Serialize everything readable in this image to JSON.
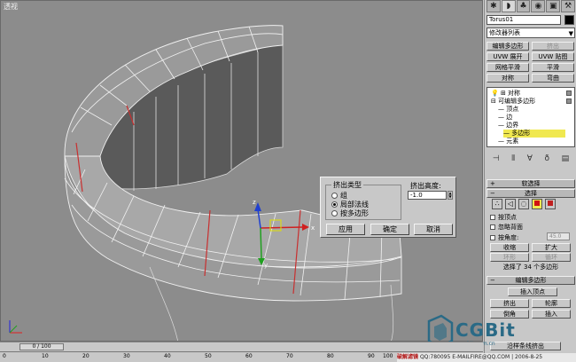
{
  "viewport": {
    "label": "透视",
    "axis_x": "x",
    "axis_y": "y",
    "axis_z": "z"
  },
  "dialog": {
    "group_title": "挤出类型",
    "options": [
      {
        "label": "组",
        "selected": false
      },
      {
        "label": "局部法线",
        "selected": true
      },
      {
        "label": "按多边形",
        "selected": false
      }
    ],
    "height_label": "挤出高度:",
    "height_value": "-1.0",
    "buttons": {
      "apply": "应用",
      "ok": "确定",
      "cancel": "取消"
    }
  },
  "panel": {
    "tab_icons": [
      "create-icon",
      "modify-icon",
      "hierarchy-icon",
      "motion-icon",
      "display-icon",
      "utilities-icon"
    ],
    "object_name": "Torus01",
    "object_color": "#000000",
    "modifier_list": "修改器列表",
    "mod_buttons": [
      {
        "label": "编辑多边形",
        "disabled": false
      },
      {
        "label": "挤出",
        "disabled": true
      },
      {
        "label": "UVW 展开",
        "disabled": false
      },
      {
        "label": "UVW 贴图",
        "disabled": false
      },
      {
        "label": "网格平滑",
        "disabled": false
      },
      {
        "label": "平滑",
        "disabled": false
      },
      {
        "label": "对称",
        "disabled": false
      },
      {
        "label": "弯曲",
        "disabled": false
      }
    ],
    "stack": [
      {
        "label": "对称",
        "indent": 0,
        "selected": false
      },
      {
        "label": "可编辑多边形",
        "indent": 0,
        "selected": false
      },
      {
        "label": "顶点",
        "indent": 1,
        "selected": false
      },
      {
        "label": "边",
        "indent": 1,
        "selected": false
      },
      {
        "label": "边界",
        "indent": 1,
        "selected": false
      },
      {
        "label": "多边形",
        "indent": 1,
        "selected": true
      },
      {
        "label": "元素",
        "indent": 1,
        "selected": false
      }
    ],
    "rollout_soft": "软选择",
    "rollout_select": "选择",
    "by_vertex": "按顶点",
    "ignore_backfacing": "忽略背面",
    "by_angle": "按角度:",
    "angle_value": "45.0",
    "shrink": "收缩",
    "grow": "扩大",
    "ring": "环形",
    "loop": "循环",
    "selection_status": "选择了 34 个多边形",
    "rollout_edit_poly": "编辑多边形",
    "insert_vertex": "插入顶点",
    "extrude": "挤出",
    "outline": "轮廓",
    "bevel": "倒角",
    "inset": "插入",
    "hinge_extrude": "沿样条线挤出"
  },
  "timeline": {
    "frame": "0 / 100",
    "ticks": [
      "0",
      "10",
      "20",
      "30",
      "40",
      "50",
      "60",
      "70",
      "80",
      "90",
      "100"
    ]
  },
  "status_bar": {
    "brand": "破解滤镜",
    "text": "QQ:780095 E-MAILFIRE@QQ.COM | 2006-8-25"
  },
  "watermark": {
    "text": "CGBit",
    "sub": "cgbit.com.cn"
  }
}
